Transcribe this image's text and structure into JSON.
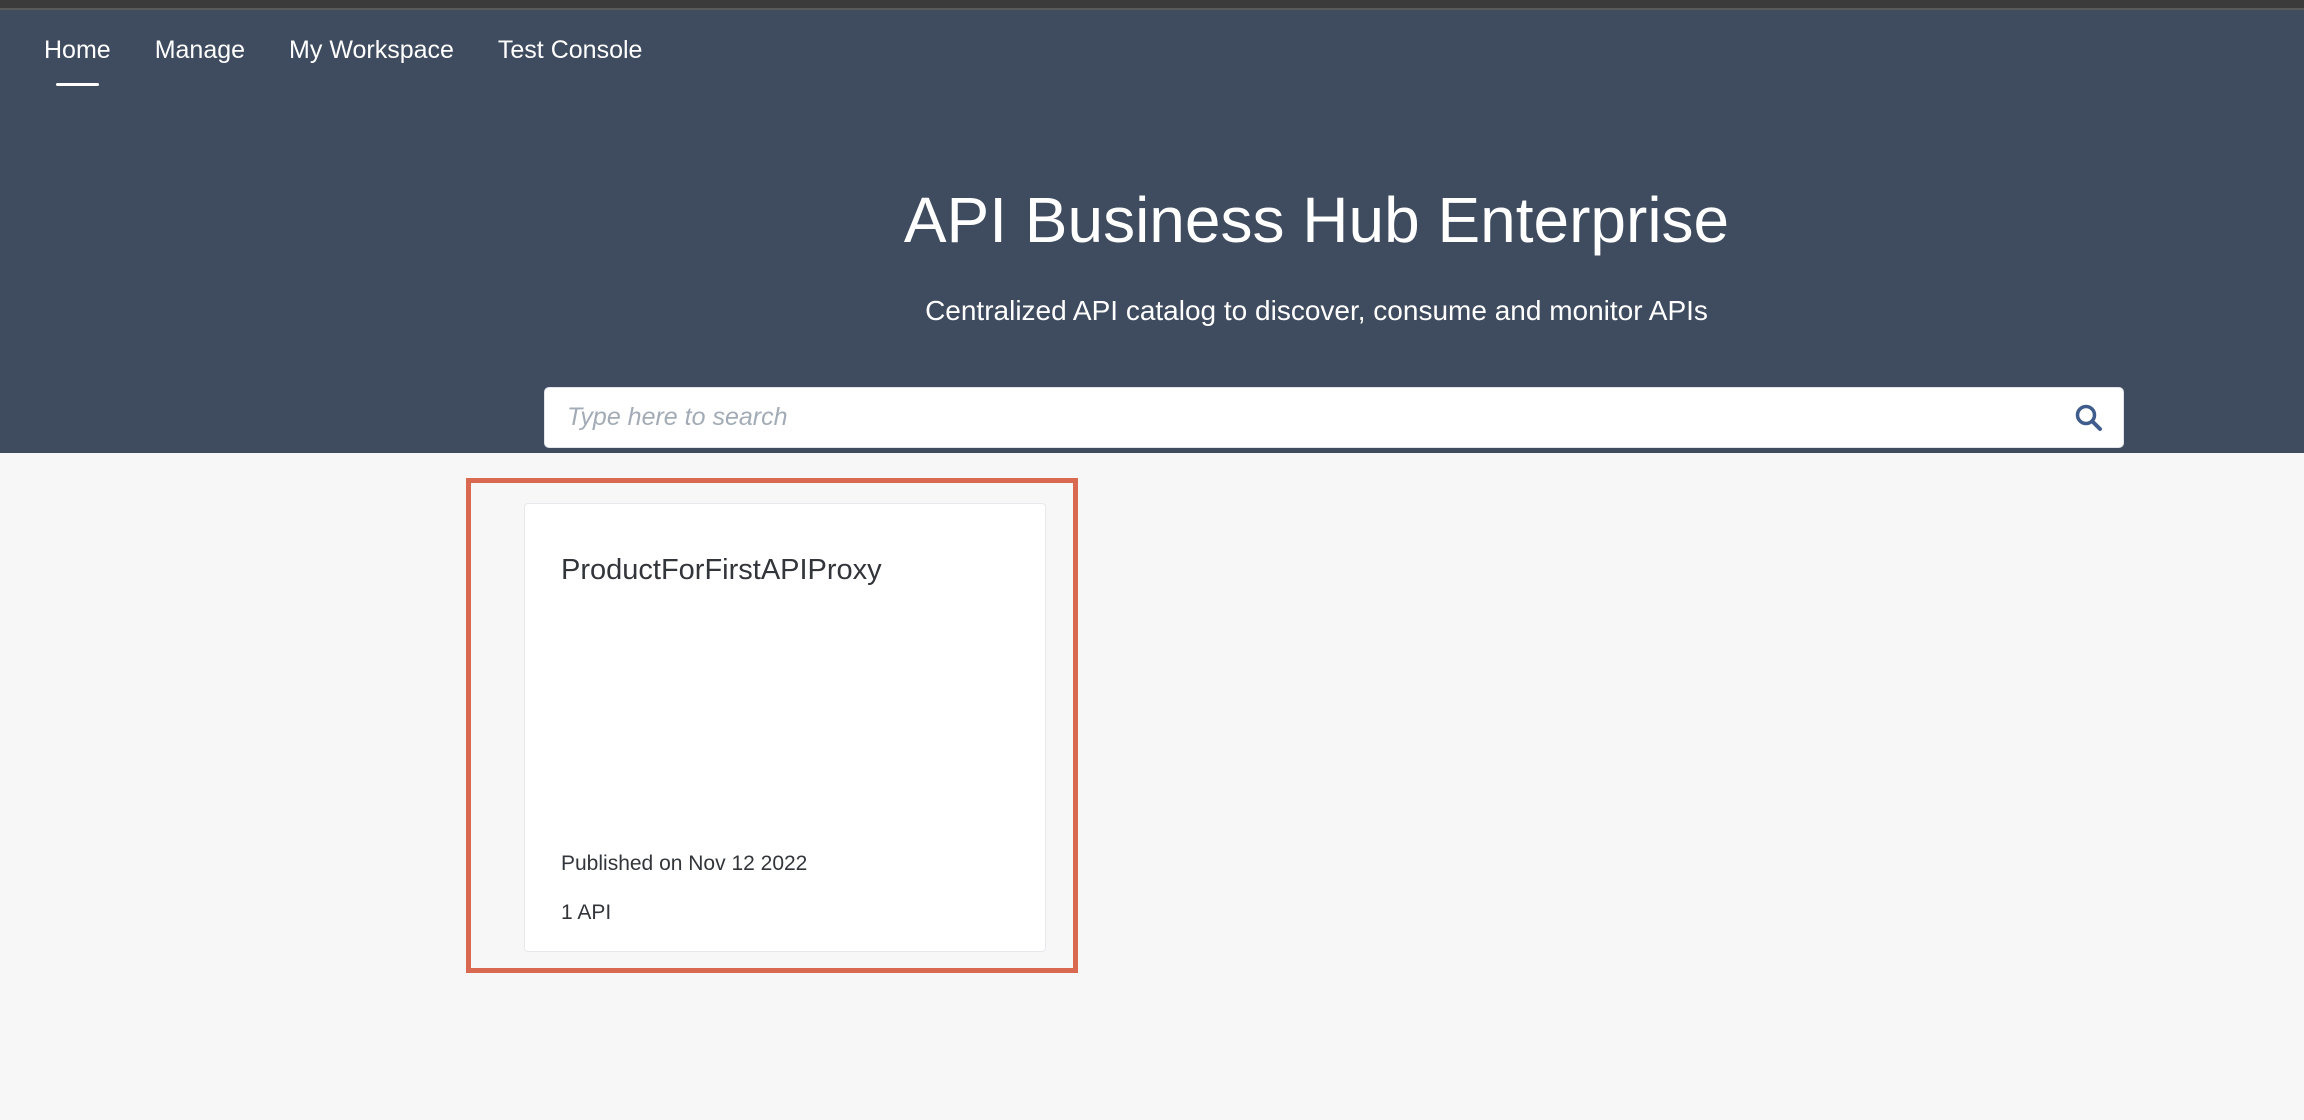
{
  "nav": {
    "tabs": [
      {
        "label": "Home",
        "active": true
      },
      {
        "label": "Manage",
        "active": false
      },
      {
        "label": "My Workspace",
        "active": false
      },
      {
        "label": "Test Console",
        "active": false
      }
    ]
  },
  "hero": {
    "title": "API Business Hub Enterprise",
    "subtitle": "Centralized API catalog to discover, consume and monitor APIs"
  },
  "search": {
    "placeholder": "Type here to search",
    "value": "",
    "icon": "search-icon"
  },
  "products": [
    {
      "name": "ProductForFirstAPIProxy",
      "published": "Published on Nov 12 2022",
      "api_count": "1 API"
    }
  ],
  "colors": {
    "header_bg": "#3f4b5e",
    "page_bg": "#f7f7f7",
    "highlight_border": "#d96a51",
    "search_icon": "#3f5c8c",
    "text_primary": "#32363a"
  }
}
